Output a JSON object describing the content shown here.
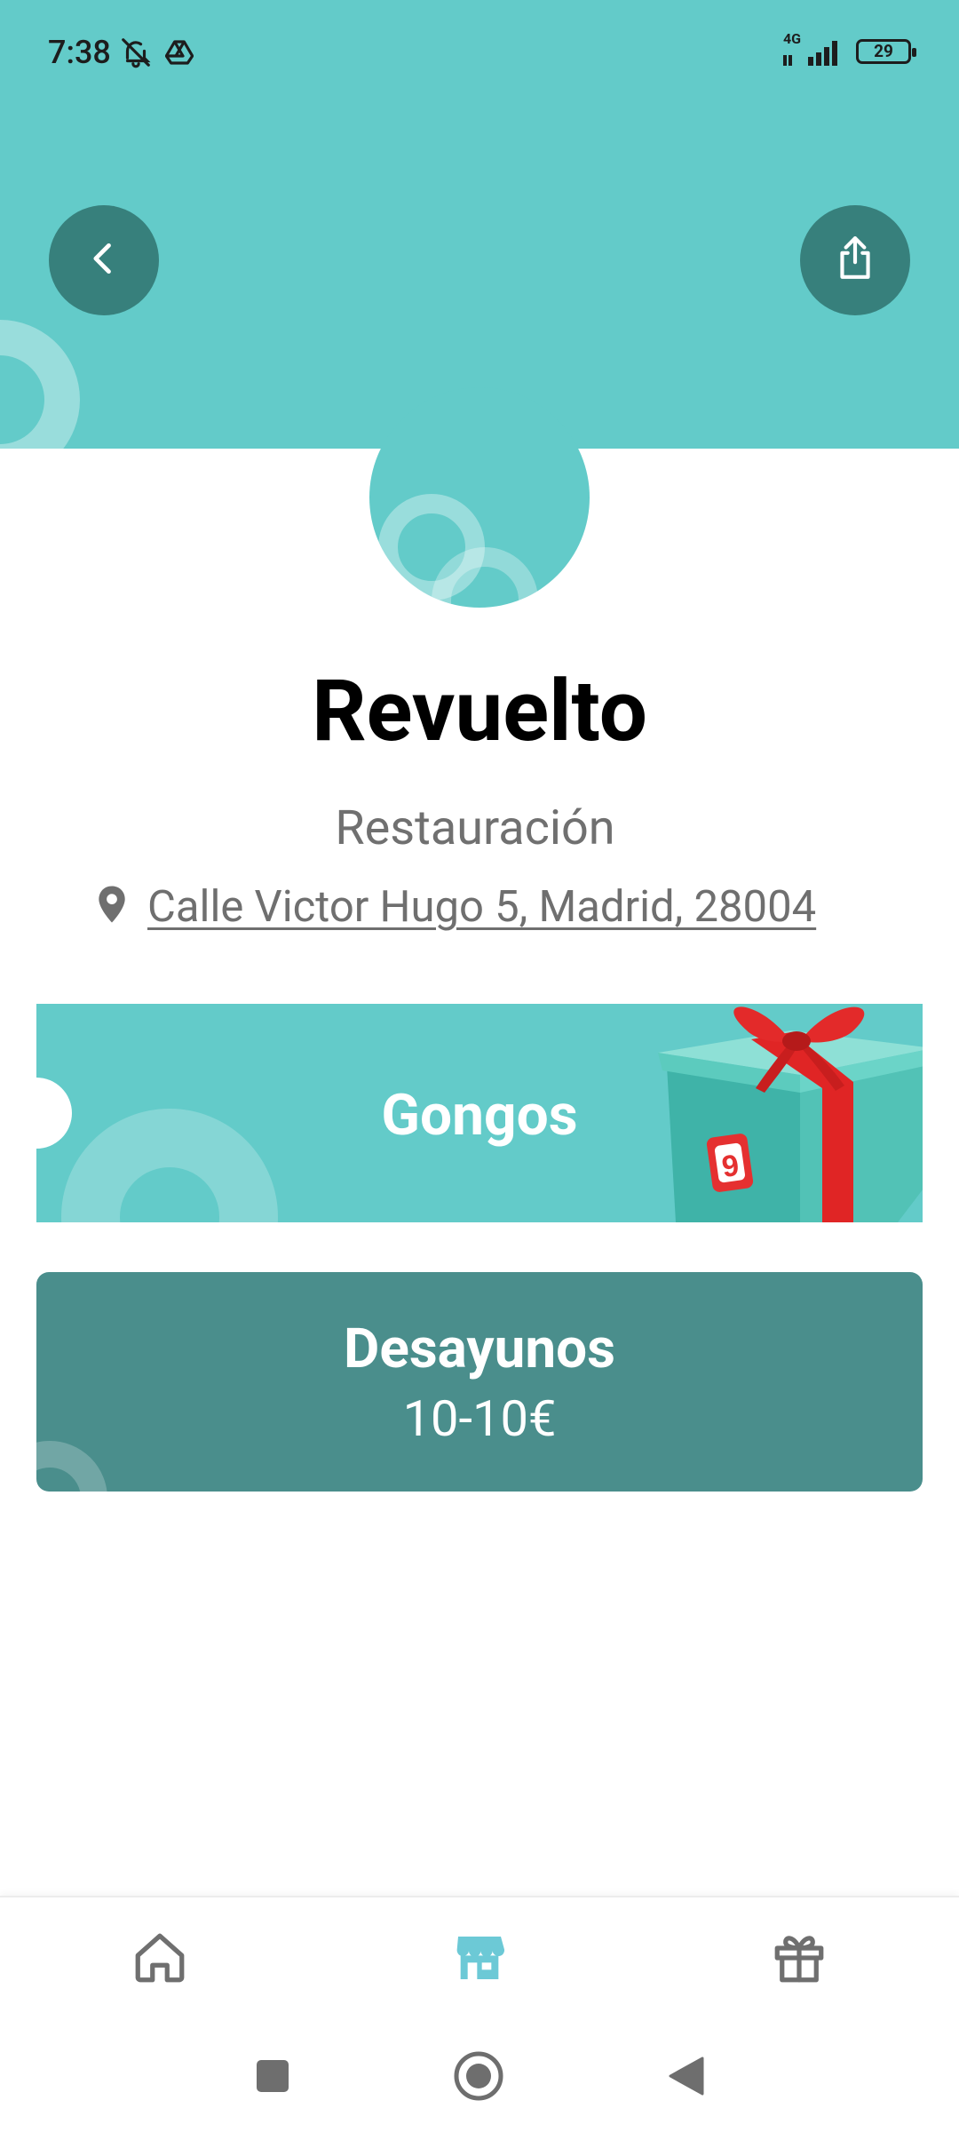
{
  "status_bar": {
    "time": "7:38",
    "network": "4G",
    "battery": "29",
    "icons": [
      "notifications-muted-icon",
      "drive-icon",
      "signal-icon",
      "battery-icon"
    ]
  },
  "header": {
    "color": "#63cbc9",
    "back_icon": "chevron-left-icon",
    "share_icon": "share-icon",
    "button_color": "#37807c"
  },
  "business": {
    "name": "Revuelto",
    "category": "Restauración",
    "address": "Calle Victor Hugo 5, Madrid, 28004",
    "address_icon": "location-pin-icon"
  },
  "rewards_card": {
    "label": "Gongos",
    "gift_badge": "9",
    "color": "#63cbc9"
  },
  "offer_card": {
    "title": "Desayunos",
    "price": "10-10€",
    "color": "#4a8e8c"
  },
  "bottom_nav": {
    "items": [
      {
        "icon": "home-icon",
        "active": false
      },
      {
        "icon": "store-icon",
        "active": true
      },
      {
        "icon": "gift-icon",
        "active": false
      }
    ],
    "active_color": "#6cc9d6",
    "inactive_color": "#6f6f6f"
  },
  "system_nav": {
    "icons": [
      "recents-icon",
      "home-circle-icon",
      "back-triangle-icon"
    ]
  }
}
